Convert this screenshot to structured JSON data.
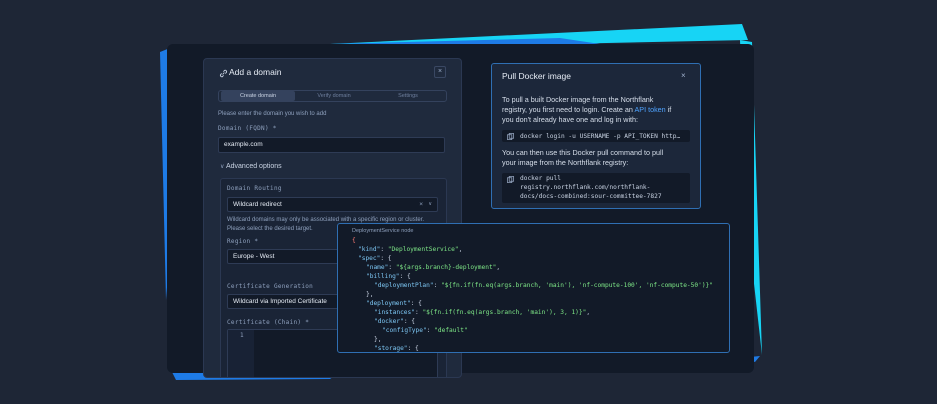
{
  "colors": {
    "accent_cyan": "#17d4f5",
    "accent_blue": "#1e7be6",
    "background": "#1e2636",
    "key": "#7ec8f5",
    "string": "#7ee787"
  },
  "domain_dialog": {
    "title": "Add a domain",
    "close": "×",
    "tabs": [
      "Create domain",
      "Verify domain",
      "Settings"
    ],
    "intro": "Please enter the domain you wish to add",
    "domain_label": "Domain (FQDN) *",
    "domain_value": "example.com",
    "advanced_label": "Advanced options",
    "routing_label": "Domain Routing",
    "routing_value": "Wildcard redirect",
    "routing_clear": "×",
    "routing_help_1": "Wildcard domains may only be associated with a specific region or cluster.",
    "routing_help_2": "Please select the desired target.",
    "region_label": "Region *",
    "region_value": "Europe - West",
    "cert_gen_label": "Certificate Generation",
    "cert_gen_value": "Wildcard via Imported Certificate",
    "cert_chain_label": "Certificate (Chain) *",
    "cert_line_no": "1"
  },
  "docker_dialog": {
    "title": "Pull Docker image",
    "close": "×",
    "text1_a": "To pull a built Docker image from the Northflank",
    "text1_b": "registry, you first need to login. Create an",
    "text1_link": "API token",
    "text1_c": "if",
    "text1_d": "you don't already have one and log in with:",
    "login_cmd": "docker login -u USERNAME -p API_TOKEN http…",
    "text2_a": "You can then use this Docker pull command to pull",
    "text2_b": "your image from the Northflank registry:",
    "pull_cmd_1": "docker pull",
    "pull_cmd_2": "registry.northflank.com/northflank-",
    "pull_cmd_3": "docs/docs-combined:sour-committee-7827"
  },
  "json_editor": {
    "header": "DeploymentService node",
    "line1": "{",
    "line2_k": "\"kind\"",
    "line2_v": "\"DeploymentService\"",
    "line3_k": "\"spec\"",
    "line4_k": "\"name\"",
    "line4_v": "\"${args.branch}-deployment\"",
    "line5_k": "\"billing\"",
    "line6_k": "\"deploymentPlan\"",
    "line6_v": "\"${fn.if(fn.eq(args.branch, 'main'), 'nf-compute-100', 'nf-compute-50')}\"",
    "line7": "},",
    "line8_k": "\"deployment\"",
    "line9_k": "\"instances\"",
    "line9_v": "\"${fn.if(fn.eq(args.branch, 'main'), 3, 1)}\"",
    "line10_k": "\"docker\"",
    "line11_k": "\"configType\"",
    "line11_v": "\"default\"",
    "line12": "},",
    "line13_k": "\"storage\""
  }
}
